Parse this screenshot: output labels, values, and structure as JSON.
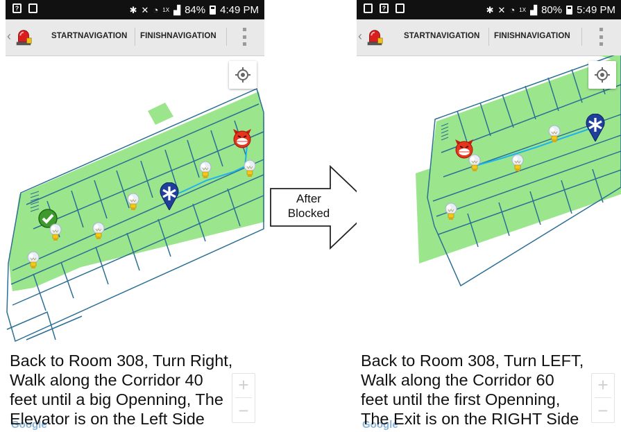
{
  "screens": [
    {
      "status": {
        "battery_percent": "84%",
        "time": "4:49 PM",
        "network_badge": "1X"
      },
      "actionbar": {
        "start_label": "STARTNAVIGATION",
        "finish_label": "FINISHNAVIGATION"
      },
      "instruction": {
        "lines": [
          "Back to Room 308, Turn Right,",
          "Walk along the Corridor 40",
          "feet until a big Openning, The",
          "Elevator is on the Left Side"
        ]
      },
      "zoom": {
        "in_label": "+",
        "out_label": "−"
      },
      "google_label": "Google"
    },
    {
      "status": {
        "battery_percent": "80%",
        "time": "5:49 PM",
        "network_badge": "1X"
      },
      "actionbar": {
        "start_label": "STARTNAVIGATION",
        "finish_label": "FINISHNAVIGATION"
      },
      "instruction": {
        "lines": [
          "Back to Room 308, Turn LEFT,",
          "Walk along the Corridor 60",
          "feet until the first Openning,",
          "The Exit is on the RIGHT Side"
        ]
      },
      "zoom": {
        "in_label": "+",
        "out_label": "−"
      },
      "google_label": "Google"
    }
  ],
  "transition": {
    "label_line1": "After",
    "label_line2": "Blocked"
  },
  "colors": {
    "map_fill": "#9be58c",
    "walls": "#2b6f95",
    "route": "#1fb3ee",
    "statusbar": "#111111",
    "actionbar": "#e9e9e9"
  },
  "icons": [
    "alarm-siren-icon",
    "locate-icon",
    "lightbulb-icon",
    "medic-marker-icon",
    "checkmark-icon",
    "devil-face-icon"
  ]
}
